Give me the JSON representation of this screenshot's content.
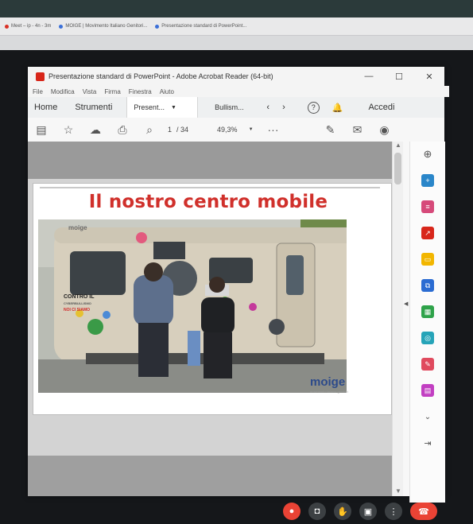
{
  "browser": {
    "tabs": [
      {
        "label": "Meet – ip - 4n - 3m"
      },
      {
        "label": "MOIGE | Movimento Italiano Genitori..."
      },
      {
        "label": "Presentazione standard di PowerPoint..."
      }
    ]
  },
  "acrobat": {
    "window_title": "Presentazione standard di PowerPoint - Adobe Acrobat Reader (64-bit)",
    "menu": [
      "File",
      "Modifica",
      "Vista",
      "Firma",
      "Finestra",
      "Aiuto"
    ],
    "tabs": {
      "home": "Home",
      "tools": "Strumenti",
      "doc1": "Present...",
      "doc2": "Bullism...",
      "signin": "Accedi"
    },
    "toolbar": {
      "page_current": "1",
      "page_total": "/ 34",
      "zoom": "49,3%"
    }
  },
  "slide": {
    "title": "Il nostro centro mobile",
    "photo_text": {
      "van_logo": "moige",
      "van_slogan_line1": "CONTRO IL",
      "van_slogan_line2": "CYBERBULLISMO",
      "van_slogan_line3": "NOI CI SIAMO"
    },
    "logo": "moige",
    "logo_sub": "movimento italiano genitori"
  },
  "colors": {
    "title_red": "#d0302b",
    "acrobat_red": "#d8261a",
    "logo_blue": "#2c4a8a",
    "meet_red": "#ea4335"
  }
}
